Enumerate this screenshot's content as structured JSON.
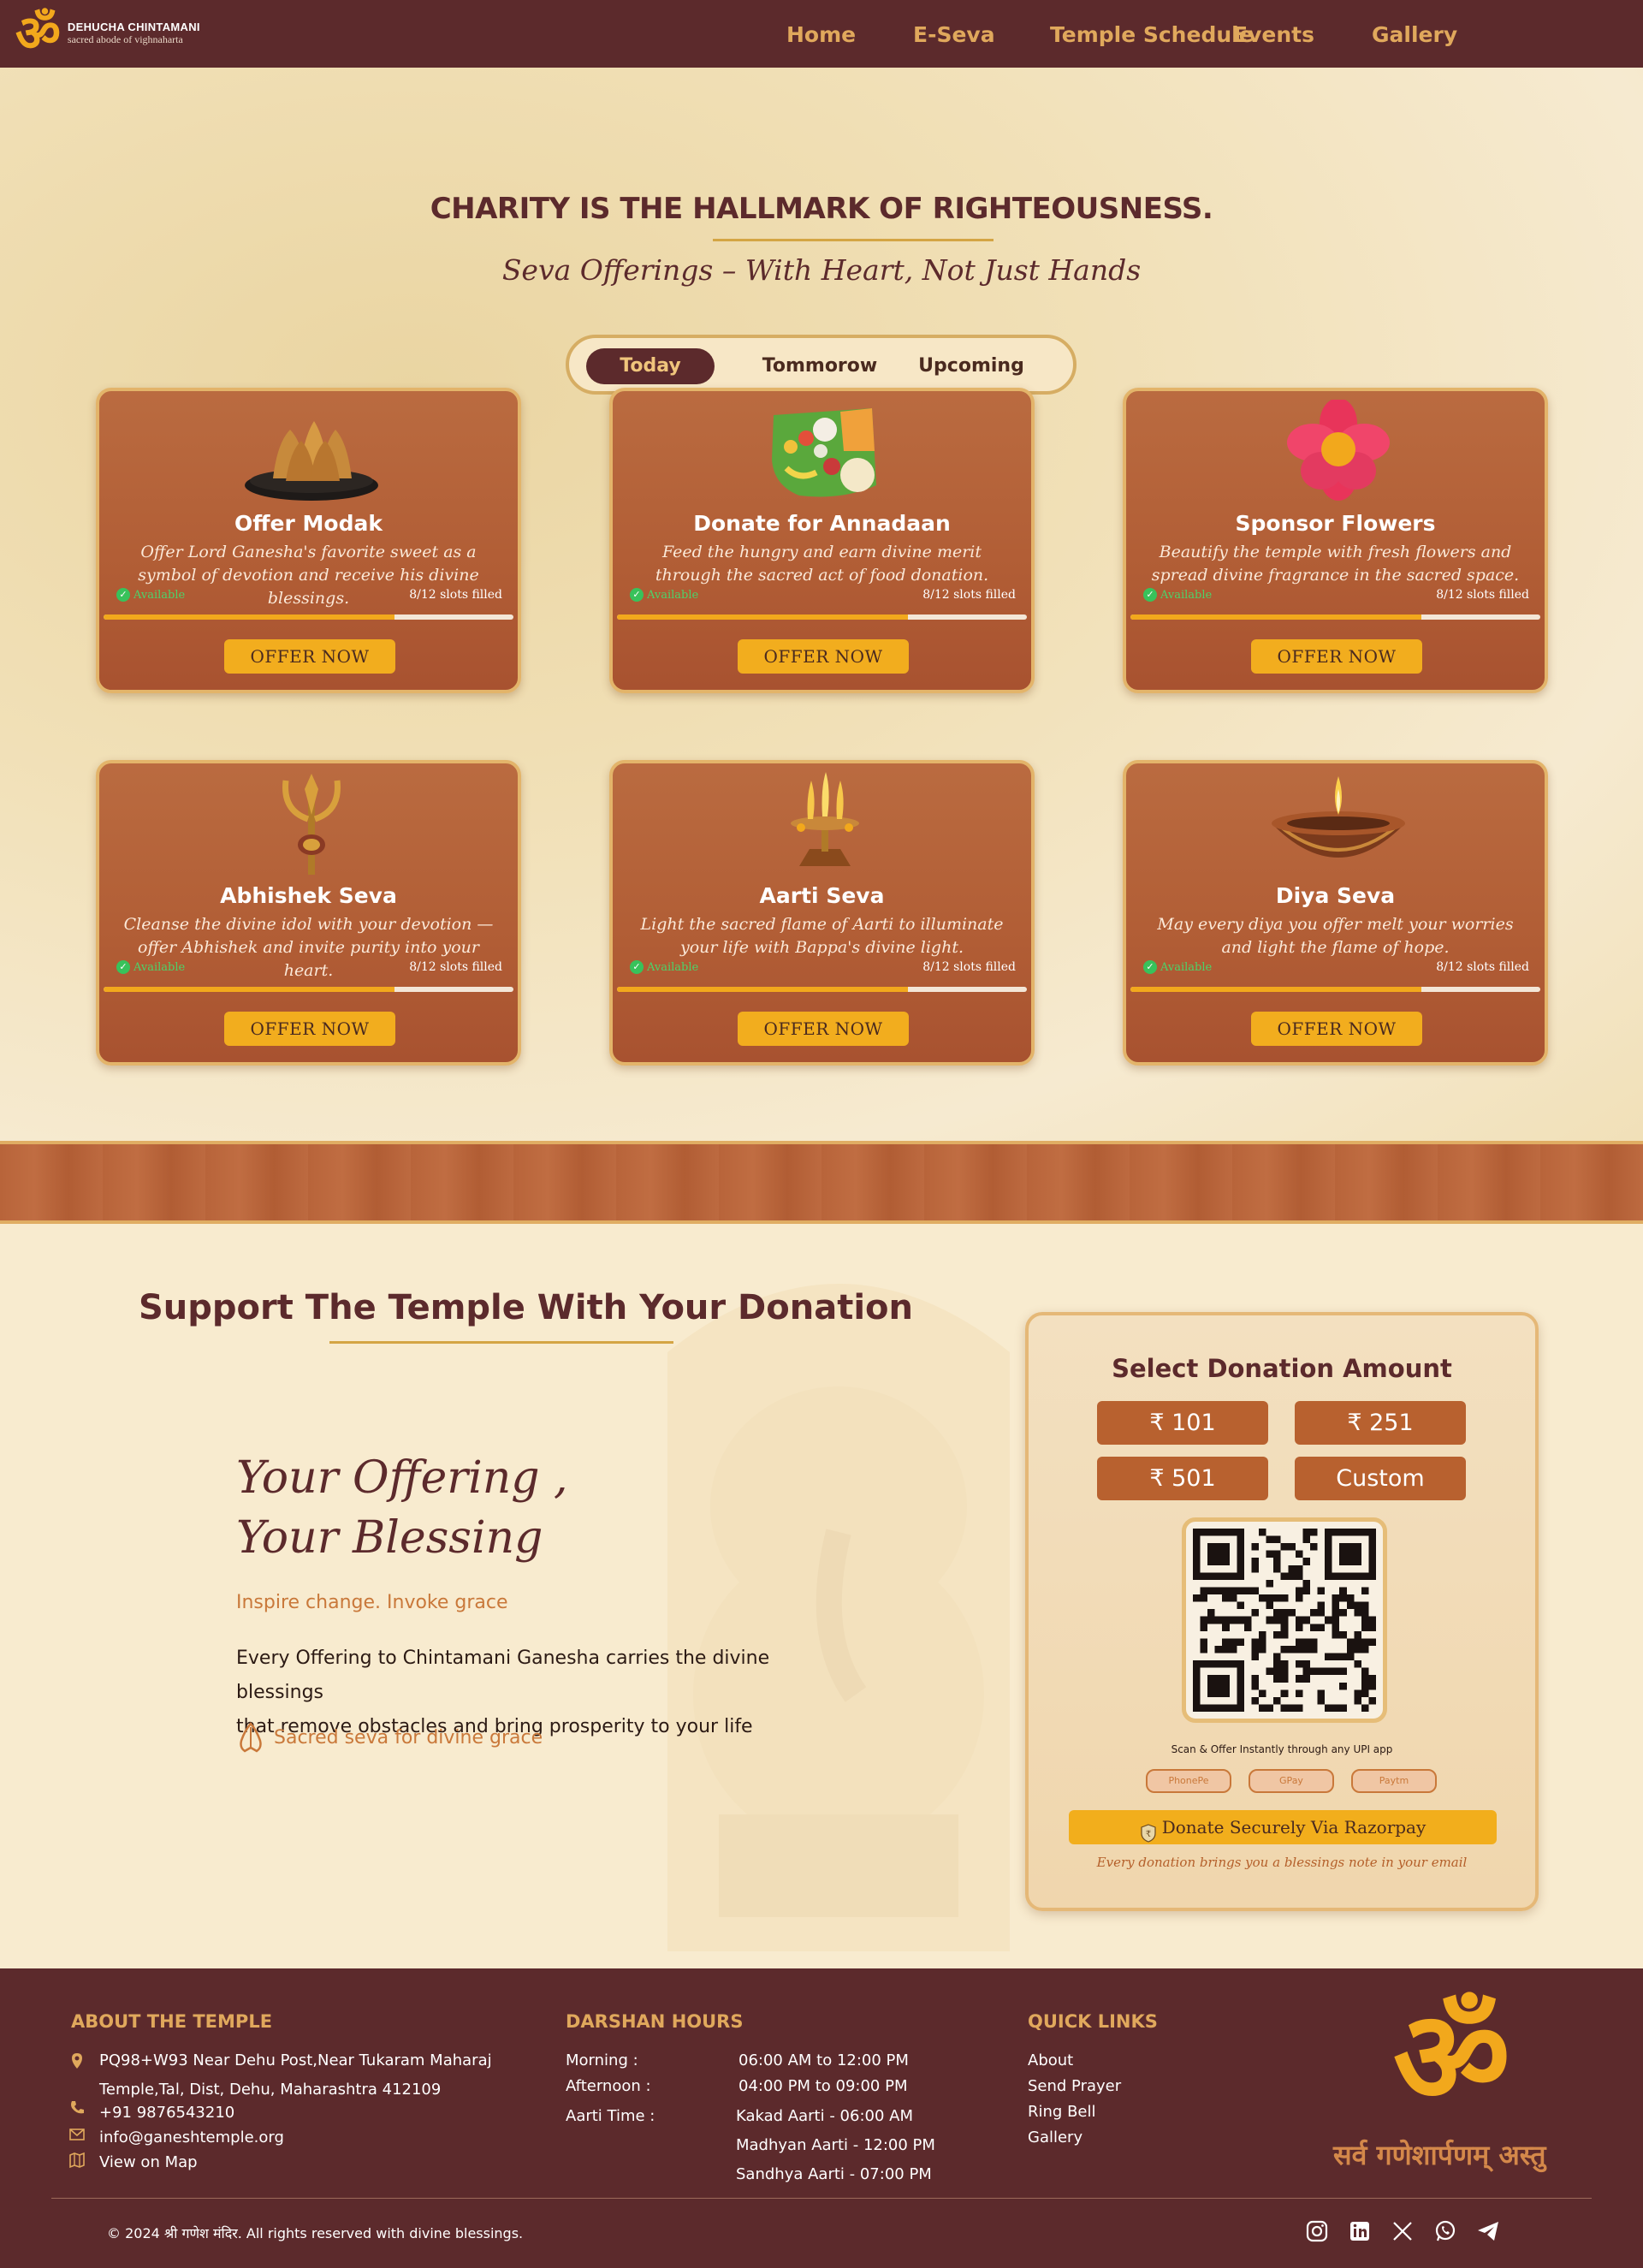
{
  "brand": {
    "logo_glyph": "ॐ",
    "title": "DEHUCHA CHINTAMANI",
    "subtitle": "sacred abode of vighnaharta",
    "accent": "#f2a81c",
    "maroon": "#5c2a2c"
  },
  "nav": {
    "home": "Home",
    "eseva": "E-Seva",
    "schedule": "Temple Schedule",
    "events": "Events",
    "gallery": "Gallery"
  },
  "hero": {
    "title": "CHARITY IS THE HALLMARK OF RIGHTEOUSNESS.",
    "subtitle": "Seva Offerings – With Heart, Not Just Hands",
    "tabs": [
      "Today",
      "Tommorow",
      "Upcoming"
    ],
    "active_tab": "Today"
  },
  "cards": [
    {
      "title": "Offer Modak",
      "desc": "Offer Lord Ganesha's favorite sweet as a symbol of devotion and receive his divine blessings.",
      "status": "Available",
      "slots": "8/12 slots filled",
      "progress": 0.71,
      "button": "OFFER NOW",
      "icon": "modak-icon"
    },
    {
      "title": "Donate for Annadaan",
      "desc": "Feed the hungry and earn divine merit through the sacred act of food donation.",
      "status": "Available",
      "slots": "8/12 slots filled",
      "progress": 0.71,
      "button": "OFFER NOW",
      "icon": "food-plate-icon"
    },
    {
      "title": "Sponsor Flowers",
      "desc": "Beautify the temple with fresh flowers and spread divine fragrance in the sacred space.",
      "status": "Available",
      "slots": "8/12 slots filled",
      "progress": 0.71,
      "button": "OFFER NOW",
      "icon": "flower-icon"
    },
    {
      "title": "Abhishek Seva",
      "desc": "Cleanse the divine idol with your devotion — offer Abhishek and invite purity into your heart.",
      "status": "Available",
      "slots": "8/12 slots filled",
      "progress": 0.71,
      "button": "OFFER NOW",
      "icon": "trishul-icon"
    },
    {
      "title": "Aarti Seva",
      "desc": "Light the sacred flame of Aarti to illuminate your life with Bappa's divine light.",
      "status": "Available",
      "slots": "8/12 slots filled",
      "progress": 0.71,
      "button": "OFFER NOW",
      "icon": "aarti-lamp-icon"
    },
    {
      "title": "Diya Seva",
      "desc": "May every diya you offer melt your worries and light the flame of hope.",
      "status": "Available",
      "slots": "8/12 slots filled",
      "progress": 0.71,
      "button": "OFFER NOW",
      "icon": "diya-icon"
    }
  ],
  "donation": {
    "title": "Support The Temple With Your Donation",
    "heading_line1": "Your Offering ,",
    "heading_line2": "Your Blessing",
    "inspire": "Inspire change. Invoke grace",
    "body_line1": "Every Offering to Chintamani Ganesha carries the divine blessings",
    "body_line2": "that remove obstacles and bring prosperity  to your life",
    "sacred": "Sacred seva for divine grace",
    "panel": {
      "title": "Select Donation Amount",
      "amounts": [
        "₹ 101",
        "₹ 251",
        "₹ 501",
        "Custom"
      ],
      "scan_text": "Scan & Offer Instantly through any UPI app",
      "upi_apps": [
        "PhonePe",
        "GPay",
        "Paytm"
      ],
      "razorpay": "Donate Securely Via Razorpay",
      "note": "Every donation brings you a blessings note in your email"
    }
  },
  "footer": {
    "about_head": "ABOUT THE TEMPLE",
    "address_line1": "PQ98+W93 Near Dehu Post,Near Tukaram Maharaj",
    "address_line2": "Temple,Tal, Dist, Dehu, Maharashtra 412109",
    "phone": "+91 9876543210",
    "email": "info@ganeshtemple.org",
    "map": "View on Map",
    "darshan_head": "DARSHAN HOURS",
    "morning_label": "Morning  :",
    "morning_time": "06:00 AM to 12:00 PM",
    "afternoon_label": "Afternoon :",
    "afternoon_time": "04:00 PM to 09:00 PM",
    "aarti_label": "Aarti Time :",
    "aarti_1": "Kakad Aarti - 06:00 AM",
    "aarti_2": "Madhyan Aarti - 12:00 PM",
    "aarti_3": "Sandhya Aarti - 07:00 PM",
    "links_head": "QUICK LINKS",
    "links": [
      "About",
      "Send Prayer",
      "Ring Bell",
      "Gallery"
    ],
    "om": "ॐ",
    "mantra": "सर्व गणेशार्पणम् अस्तु",
    "copyright": "© 2024 श्री गणेश मंदिर. All rights reserved with divine blessings.",
    "social": [
      "instagram-icon",
      "linkedin-icon",
      "x-icon",
      "whatsapp-icon",
      "telegram-icon"
    ]
  }
}
